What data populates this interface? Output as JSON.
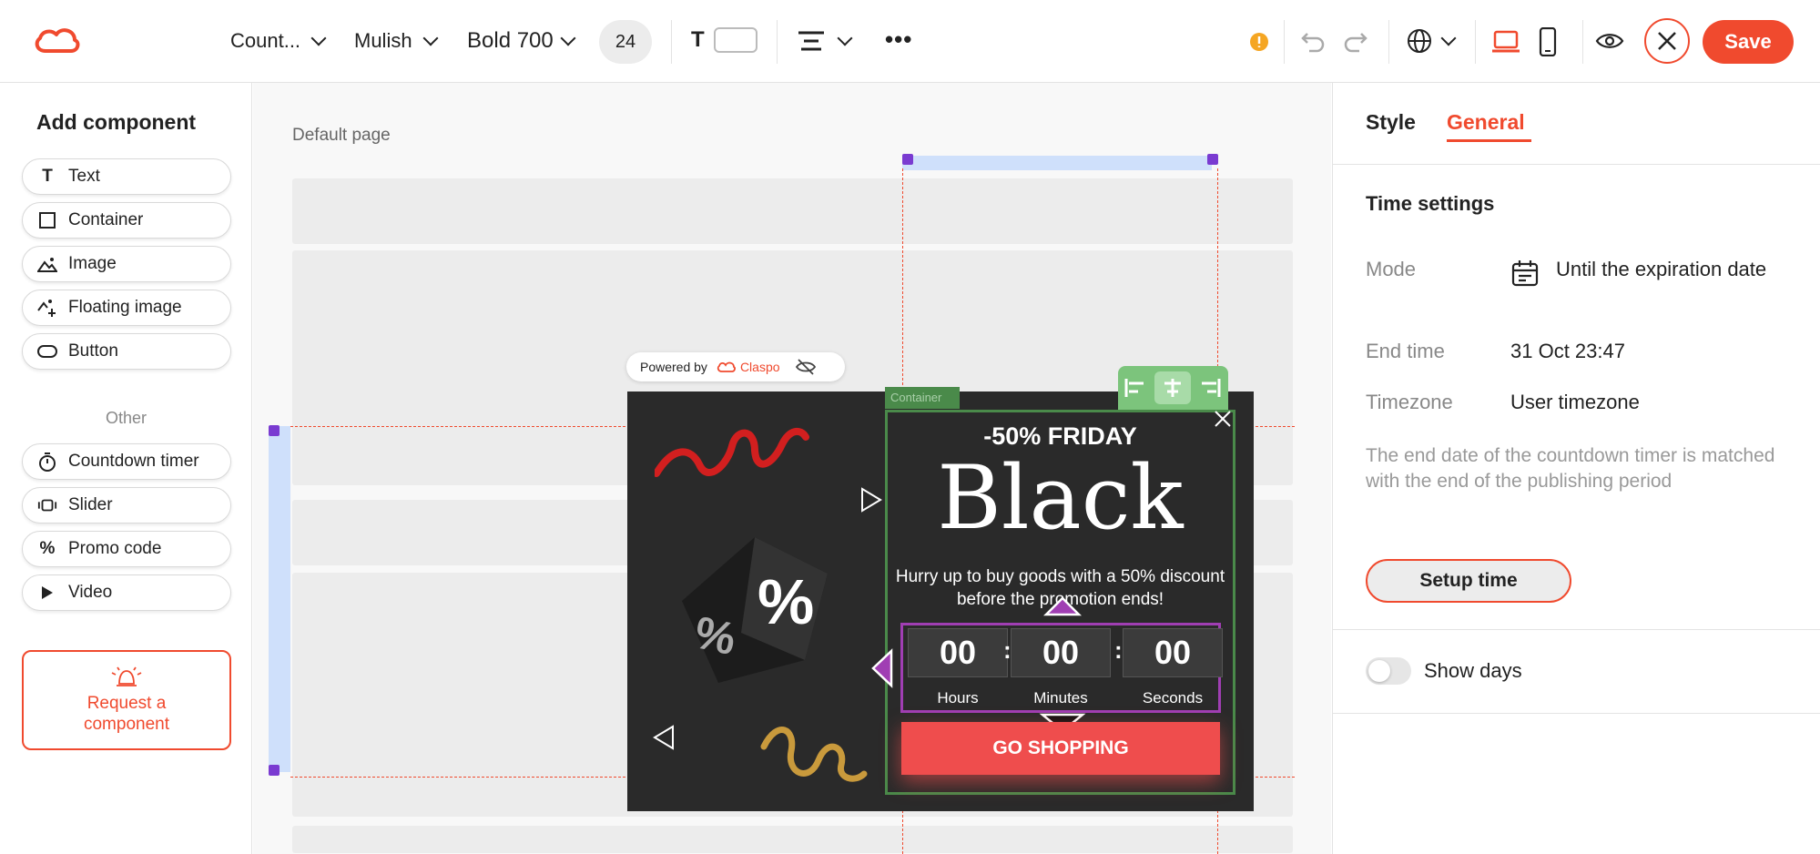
{
  "toolbar": {
    "element_select": "Count...",
    "font_family": "Mulish",
    "font_weight": "Bold 700",
    "font_size": "24",
    "text_color_icon": "T",
    "save_label": "Save"
  },
  "left_panel": {
    "title": "Add component",
    "components": [
      {
        "label": "Text",
        "icon": "text-icon"
      },
      {
        "label": "Container",
        "icon": "container-icon"
      },
      {
        "label": "Image",
        "icon": "image-icon"
      },
      {
        "label": "Floating image",
        "icon": "floating-image-icon"
      },
      {
        "label": "Button",
        "icon": "button-icon"
      }
    ],
    "other_label": "Other",
    "other_components": [
      {
        "label": "Countdown timer",
        "icon": "timer-icon"
      },
      {
        "label": "Slider",
        "icon": "slider-icon"
      },
      {
        "label": "Promo code",
        "icon": "percent-icon"
      },
      {
        "label": "Video",
        "icon": "play-icon"
      }
    ],
    "request_label": "Request a component"
  },
  "canvas": {
    "page_label": "Default page",
    "powered_by": "Powered by",
    "brand": "Claspo",
    "container_tag": "Container",
    "popup": {
      "headline": "-50% FRIDAY",
      "big_word": "Black",
      "description": "Hurry up to buy goods with a 50% discount before the promotion ends!",
      "timer": [
        {
          "value": "00",
          "label": "Hours"
        },
        {
          "value": "00",
          "label": "Minutes"
        },
        {
          "value": "00",
          "label": "Seconds"
        }
      ],
      "separator": ":",
      "cta": "GO SHOPPING"
    }
  },
  "right_panel": {
    "tabs": {
      "style": "Style",
      "general": "General",
      "active": "General"
    },
    "section_title": "Time settings",
    "mode_label": "Mode",
    "mode_value": "Until the expiration date",
    "end_time_label": "End time",
    "end_time_value": "31 Oct 23:47",
    "timezone_label": "Timezone",
    "timezone_value": "User timezone",
    "help_text": "The end date of the countdown timer is matched with the end of the publishing period",
    "setup_button": "Setup time",
    "show_days_label": "Show days",
    "show_days_on": false
  },
  "colors": {
    "accent": "#f04a2e",
    "container_green": "#4a8a4a",
    "timer_purple": "#a03eb3",
    "cta_red": "#ef4d4d",
    "warning": "#f5a623",
    "popup_bg": "#2a2a2a"
  }
}
